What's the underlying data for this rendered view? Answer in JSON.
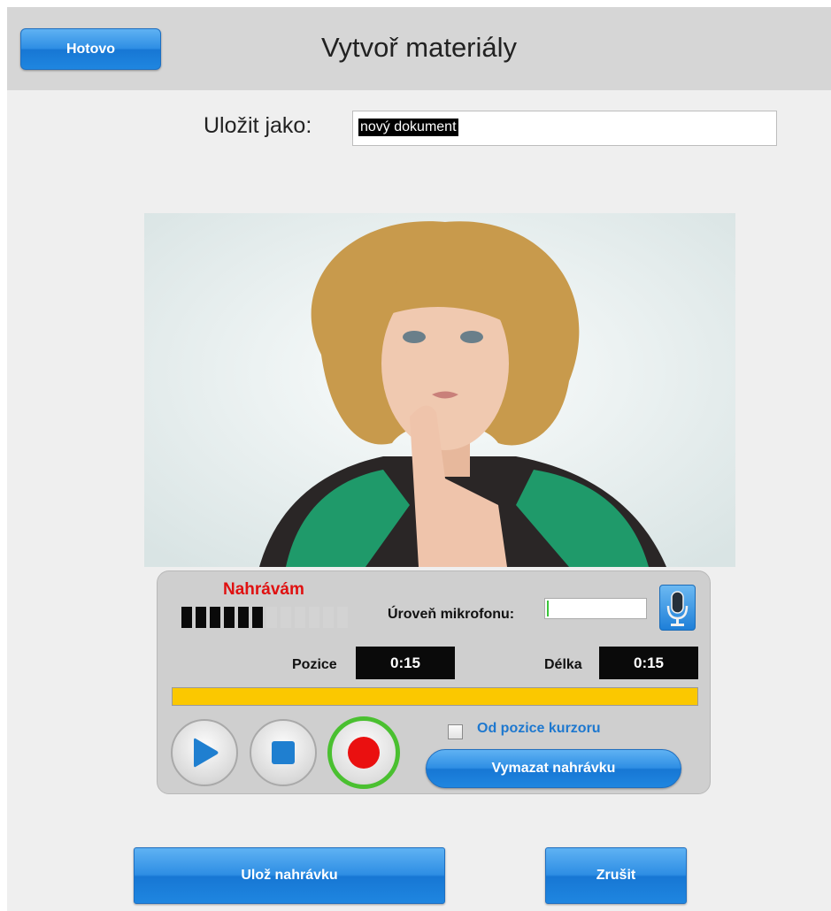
{
  "header": {
    "done_label": "Hotovo",
    "title": "Vytvoř materiály"
  },
  "save_as": {
    "label": "Uložit jako:",
    "value": "nový dokument"
  },
  "recorder": {
    "status": "Nahrávám",
    "level_bars": {
      "total": 12,
      "active": 6
    },
    "mic_level_label": "Úroveň mikrofonu:",
    "mic_level": 0.02,
    "position_label": "Pozice",
    "position_value": "0:15",
    "length_label": "Délka",
    "length_value": "0:15",
    "progress": 1.0,
    "from_cursor_label": "Od pozice kurzoru",
    "from_cursor_checked": false,
    "clear_label": "Vymazat nahrávku"
  },
  "footer": {
    "save_label": "Ulož nahrávku",
    "cancel_label": "Zrušit"
  },
  "colors": {
    "accent": "#2e8ee4",
    "recording": "#e01010",
    "record_ring": "#4ac030",
    "progress": "#fbc800"
  },
  "icons": [
    "play-icon",
    "stop-icon",
    "record-icon",
    "microphone-icon"
  ]
}
